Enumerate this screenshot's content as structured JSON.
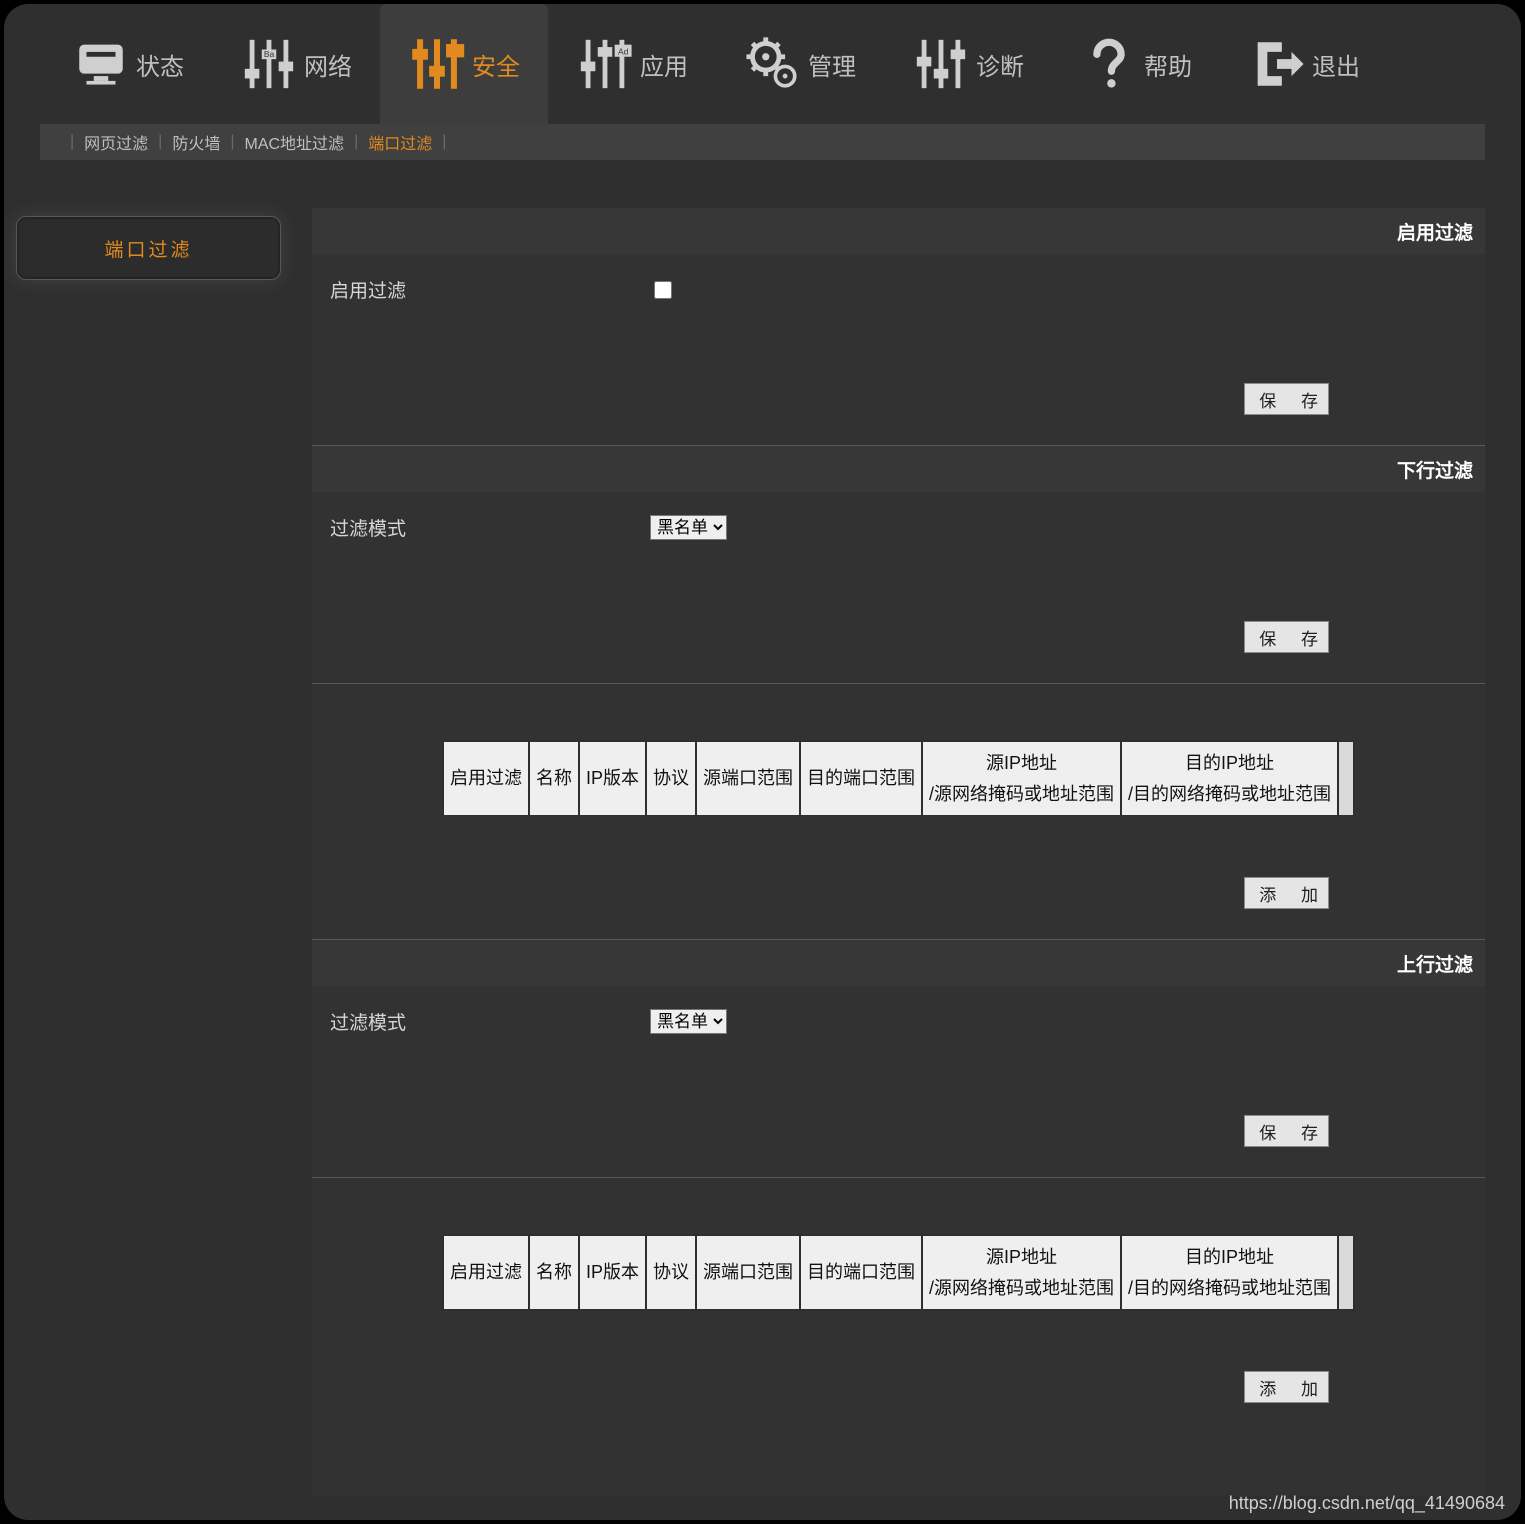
{
  "topnav": [
    {
      "id": "status",
      "label": "状态",
      "icon": "monitor"
    },
    {
      "id": "network",
      "label": "网络",
      "icon": "sliders-ba"
    },
    {
      "id": "security",
      "label": "安全",
      "icon": "sliders-ad",
      "active": true
    },
    {
      "id": "app",
      "label": "应用",
      "icon": "sliders-ad2"
    },
    {
      "id": "manage",
      "label": "管理",
      "icon": "gear"
    },
    {
      "id": "diagnose",
      "label": "诊断",
      "icon": "sliders-plain"
    },
    {
      "id": "help",
      "label": "帮助",
      "icon": "question"
    },
    {
      "id": "exit",
      "label": "退出",
      "icon": "exit"
    }
  ],
  "subnav": [
    {
      "id": "web-filter",
      "label": "网页过滤"
    },
    {
      "id": "firewall",
      "label": "防火墙"
    },
    {
      "id": "mac-filter",
      "label": "MAC地址过滤"
    },
    {
      "id": "port-filter",
      "label": "端口过滤",
      "active": true
    }
  ],
  "side": {
    "portFilterLabel": "端口过滤"
  },
  "section_enable": {
    "title": "启用过滤",
    "rowLabel": "启用过滤",
    "saveBtn": "保 存"
  },
  "section_down": {
    "title": "下行过滤",
    "modeLabel": "过滤模式",
    "modeValue": "黑名单",
    "saveBtn": "保 存",
    "addBtn": "添 加"
  },
  "section_up": {
    "title": "上行过滤",
    "modeLabel": "过滤模式",
    "modeValue": "黑名单",
    "saveBtn": "保 存",
    "addBtn": "添 加"
  },
  "table_headers": {
    "enable": "启用过滤",
    "name": "名称",
    "ipver": "IP版本",
    "proto": "协议",
    "srcport": "源端口范围",
    "dstport": "目的端口范围",
    "srcip_l1": "源IP地址",
    "srcip_l2": "/源网络掩码或地址范围",
    "dstip_l1": "目的IP地址",
    "dstip_l2": "/目的网络掩码或地址范围"
  },
  "watermark": "https://blog.csdn.net/qq_41490684"
}
